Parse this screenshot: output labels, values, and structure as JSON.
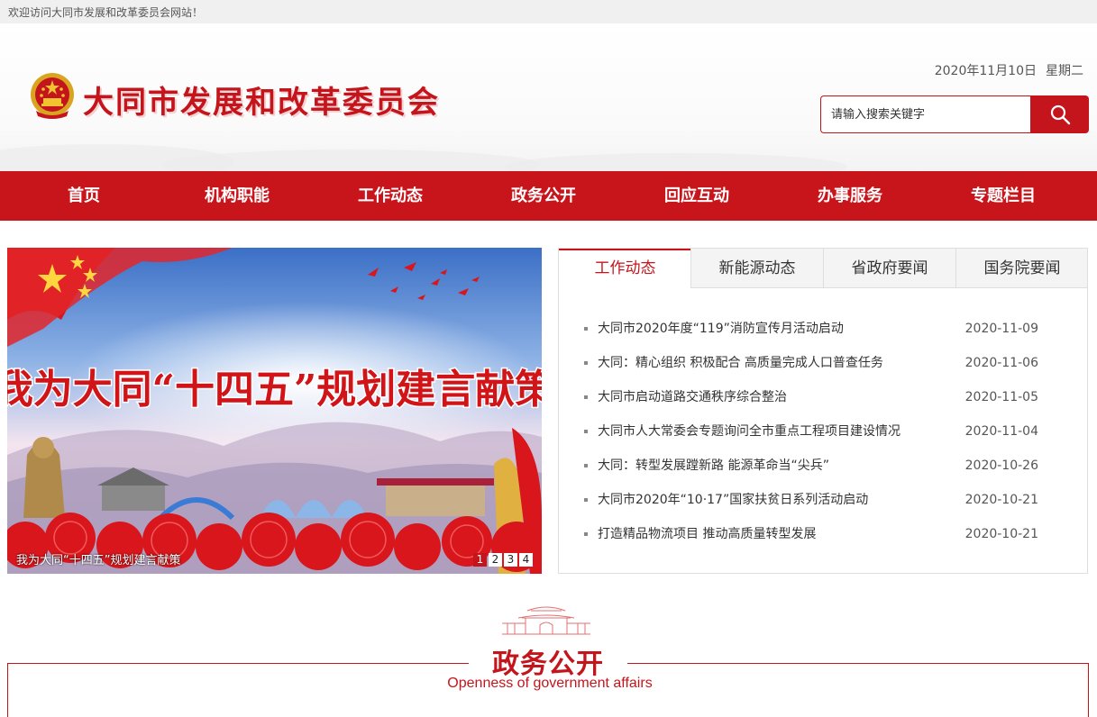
{
  "topbar": {
    "welcome": "欢迎访问大同市发展和改革委员会网站！"
  },
  "header": {
    "site_title": "大同市发展和改革委员会",
    "date": "2020年11月10日",
    "weekday": "星期二",
    "search": {
      "placeholder": "请输入搜索关键字",
      "icon": "search-icon"
    }
  },
  "nav": {
    "items": [
      "首页",
      "机构职能",
      "工作动态",
      "政务公开",
      "回应互动",
      "办事服务",
      "专题栏目"
    ]
  },
  "banner": {
    "headline": "我为大同“十四五”规划建言献策",
    "caption": "我为大同“十四五”规划建言献策",
    "pages": [
      "1",
      "2",
      "3",
      "4"
    ],
    "active_page": "1"
  },
  "news": {
    "tabs": [
      "工作动态",
      "新能源动态",
      "省政府要闻",
      "国务院要闻"
    ],
    "active_tab": "工作动态",
    "items": [
      {
        "title": "大同市2020年度“119”消防宣传月活动启动",
        "date": "2020-11-09"
      },
      {
        "title": "大同：精心组织 积极配合 高质量完成人口普查任务",
        "date": "2020-11-06"
      },
      {
        "title": "大同市启动道路交通秩序综合整治",
        "date": "2020-11-05"
      },
      {
        "title": "大同市人大常委会专题询问全市重点工程项目建设情况",
        "date": "2020-11-04"
      },
      {
        "title": "大同：转型发展蹚新路 能源革命当“尖兵”",
        "date": "2020-10-26"
      },
      {
        "title": "大同市2020年“10·17”国家扶贫日系列活动启动",
        "date": "2020-10-21"
      },
      {
        "title": "打造精品物流项目 推动高质量转型发展",
        "date": "2020-10-21"
      }
    ]
  },
  "section": {
    "title": "政务公开",
    "subtitle": "Openness of government affairs"
  },
  "colors": {
    "brand_red": "#c4151c",
    "nav_red": "#c8151c"
  }
}
